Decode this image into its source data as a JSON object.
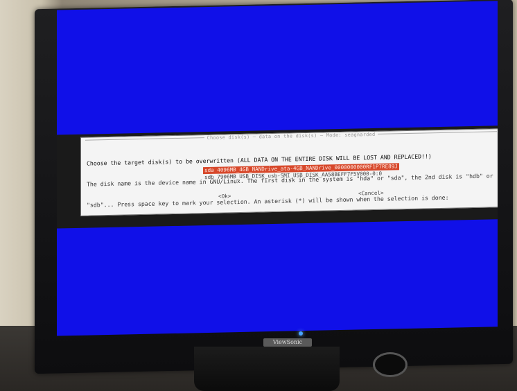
{
  "dialog": {
    "title": "Choose disk(s) — data on the disk(s) — Mode: seagnarded",
    "message_lines": [
      "Choose the target disk(s) to be overwritten (ALL DATA ON THE ENTIRE DISK WILL BE LOST AND REPLACED!!)",
      "The disk name is the device name in GNU/Linux. The first disk in the system is \"hda\" or \"sda\", the 2nd disk is \"hdb\" or",
      "\"sdb\"... Press space key to mark your selection. An asterisk (*) will be shown when the selection is done:"
    ],
    "disks": [
      {
        "label": "sda 4096MB_4GB_NANDrive_ata-4GB_NANDrive_0000000000RF1P7RE89J",
        "selected": true
      },
      {
        "label": "sdb 7906MB_USB_DISK_usb-SMI_USB_DISK_AA58BEFF7F5V000-0:0",
        "selected": false
      }
    ],
    "ok_label": "<Ok>",
    "cancel_label": "<Cancel>"
  },
  "monitor": {
    "brand": "ViewSonic"
  },
  "colors": {
    "screen_bg": "#1010e8",
    "dialog_bg": "#f4f4f4",
    "selection_bg": "#d7482b"
  }
}
